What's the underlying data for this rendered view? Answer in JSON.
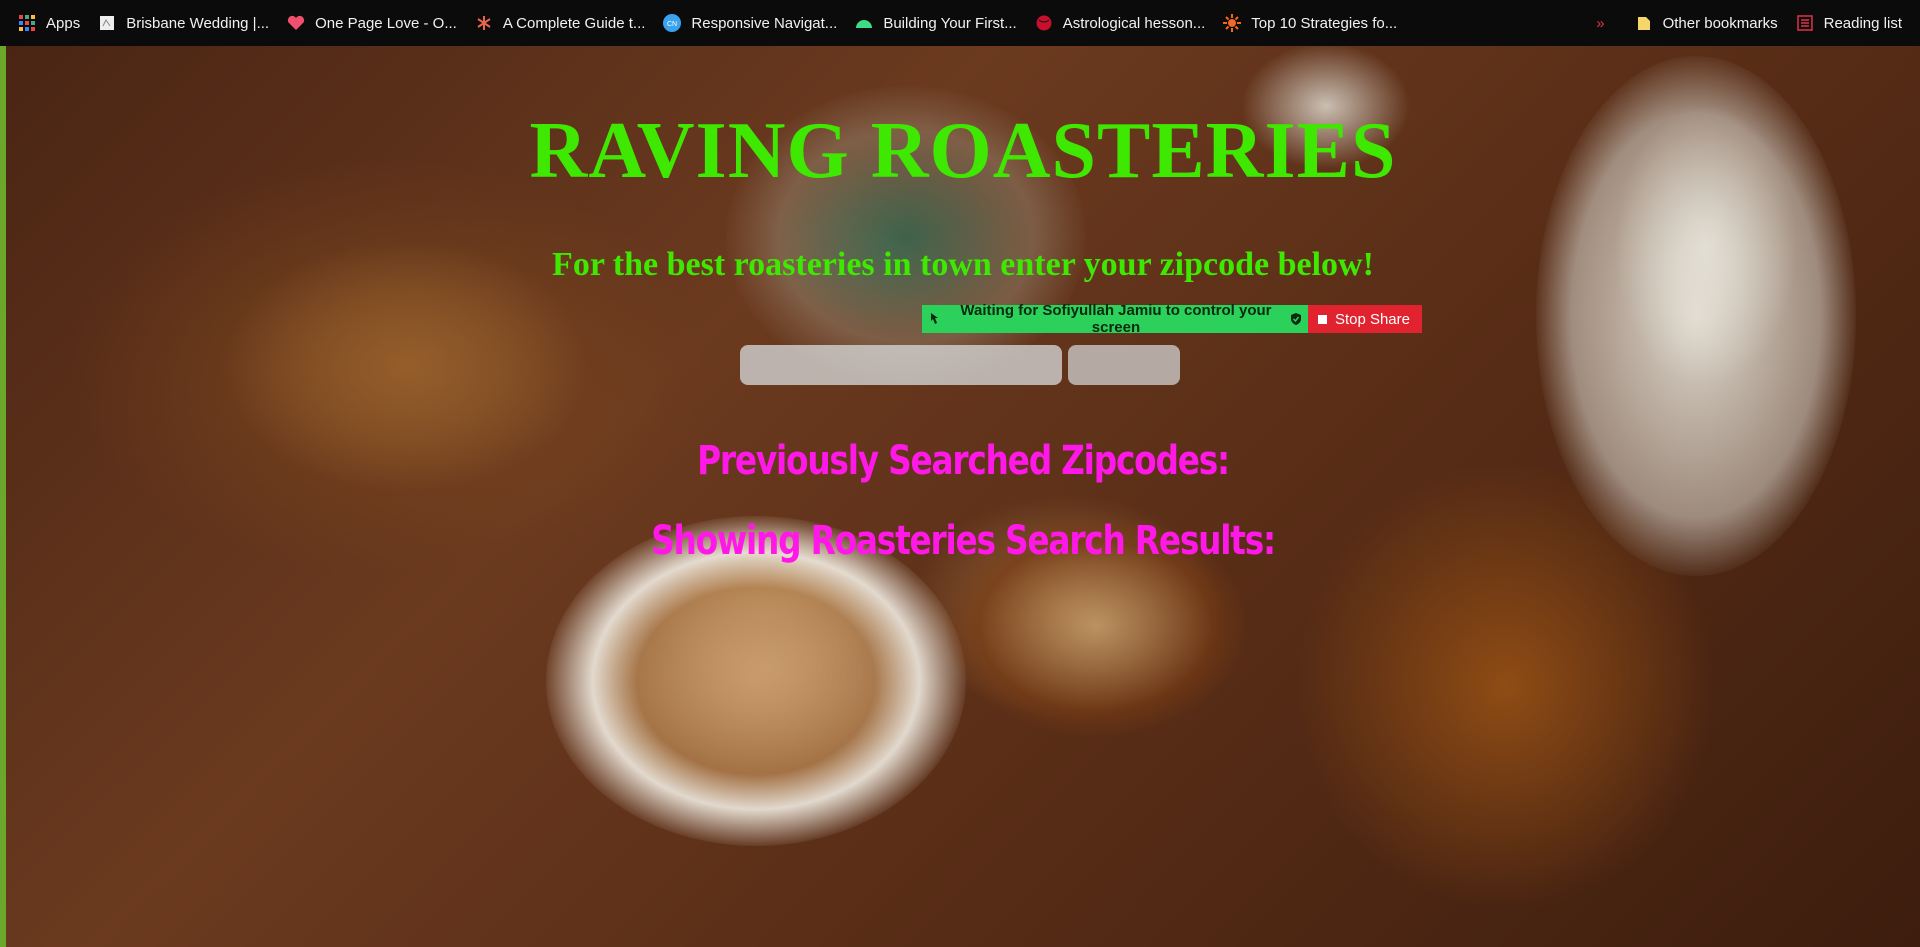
{
  "bookmarks_bar": {
    "items": [
      {
        "label": "Apps",
        "icon": "apps-grid-icon"
      },
      {
        "label": "Brisbane Wedding |...",
        "icon": "page-icon"
      },
      {
        "label": "One Page Love - O...",
        "icon": "heart-icon"
      },
      {
        "label": "A Complete Guide t...",
        "icon": "asterisk-icon"
      },
      {
        "label": "Responsive Navigat...",
        "icon": "cn-icon"
      },
      {
        "label": "Building Your First...",
        "icon": "android-icon"
      },
      {
        "label": "Astrological hesson...",
        "icon": "globe-icon"
      },
      {
        "label": "Top 10 Strategies fo...",
        "icon": "sun-icon"
      }
    ],
    "overflow": "»",
    "other_bookmarks": "Other bookmarks",
    "reading_list": "Reading list"
  },
  "page": {
    "title": "RAVING ROASTERIES",
    "subtitle": "For the best roasteries in town enter your zipcode below!",
    "zip_input": {
      "value": "",
      "placeholder": ""
    },
    "previous_heading": "Previously Searched Zipcodes:",
    "results_heading": "Showing Roasteries Search Results:"
  },
  "screen_share": {
    "message": "Waiting for Sofiyullah Jamiu to control your screen",
    "stop_label": "Stop Share"
  },
  "colors": {
    "title_green": "#3fe800",
    "heading_magenta": "#ff18e8",
    "share_green": "#2bd15a",
    "stop_red": "#e0232f"
  }
}
